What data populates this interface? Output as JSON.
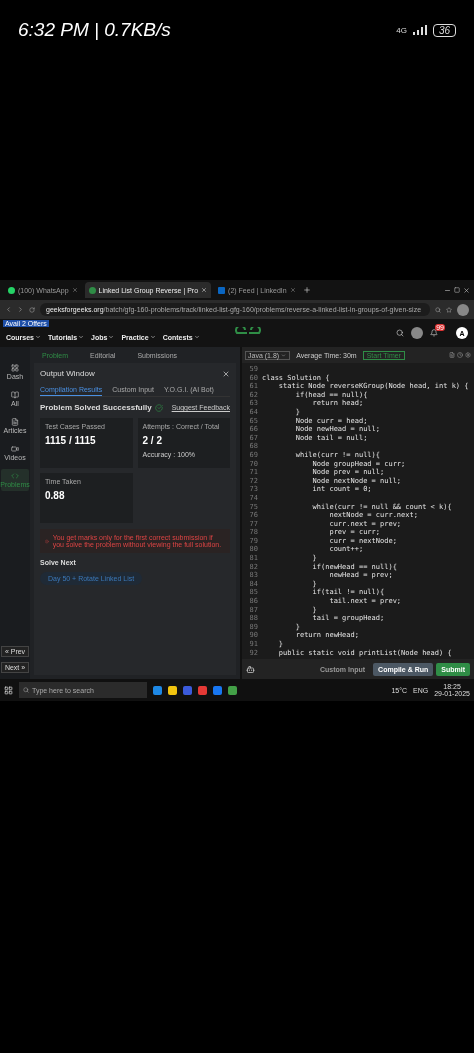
{
  "phone_status": {
    "time": "6:32 PM | 0.7KB/s",
    "network": "4G",
    "battery": "36"
  },
  "browser": {
    "tabs": [
      {
        "title": "(100) WhatsApp",
        "selected": false
      },
      {
        "title": "Linked List Group Reverse | Pro",
        "selected": true
      },
      {
        "title": "(2) Feed | LinkedIn",
        "selected": false
      }
    ],
    "url_domain": "geeksforgeeks.org",
    "url_path": "/batch/gfg-160-problems/track/linked-list-gfg-160/problems/reverse-a-linked-list-in-groups-of-given-size"
  },
  "site_nav": {
    "offer_badge": "Avail 2 Offers",
    "items": [
      "Courses",
      "Tutorials",
      "Jobs",
      "Practice",
      "Contests"
    ],
    "notifications": "99",
    "avatar": "A"
  },
  "problem_tabs": [
    {
      "label": "Problem",
      "selected": true
    },
    {
      "label": "Editorial",
      "selected": false
    },
    {
      "label": "Submissions",
      "selected": false
    }
  ],
  "sidebar": {
    "items": [
      {
        "label": "Dash",
        "selected": false
      },
      {
        "label": "All",
        "selected": false
      },
      {
        "label": "Articles",
        "selected": false
      },
      {
        "label": "Videos",
        "selected": false
      },
      {
        "label": "Problems",
        "selected": true
      }
    ],
    "prev": "« Prev",
    "next": "Next »"
  },
  "output_window": {
    "title": "Output Window",
    "tabs": [
      {
        "label": "Compilation Results",
        "selected": true
      },
      {
        "label": "Custom Input",
        "selected": false
      },
      {
        "label": "Y.O.G.I. (AI Bot)",
        "selected": false
      }
    ],
    "status": "Problem Solved Successfully",
    "feedback": "Suggest Feedback",
    "cards": [
      {
        "label": "Test Cases Passed",
        "value": "1115 / 1115"
      },
      {
        "label": "Attempts : Correct / Total",
        "value": "2 / 2",
        "extra_label": "Accuracy :",
        "extra_value": "100%"
      },
      {
        "label": "Time Taken",
        "value": "0.88"
      }
    ],
    "note": "You get marks only for the first correct submission if you solve the problem without viewing the full solution.",
    "solve_next": "Solve Next",
    "next_problem": "Day 50 + Rotate Linked List"
  },
  "editor": {
    "language": "Java (1.8)",
    "average_time": "Average Time: 30m",
    "timer": "Start Timer",
    "lines": [
      {
        "number": "59"
      },
      {
        "number": "60",
        "text": "class Solution {"
      },
      {
        "number": "61",
        "text": "    static Node reverseKGroup(Node head, int k) {"
      },
      {
        "number": "62",
        "text": "        if(head == null){"
      },
      {
        "number": "63",
        "text": "            return head;"
      },
      {
        "number": "64",
        "text": "        }"
      },
      {
        "number": "65",
        "text": "        Node curr = head;"
      },
      {
        "number": "66",
        "text": "        Node newHead = null;"
      },
      {
        "number": "67",
        "text": "        Node tail = null;"
      },
      {
        "number": "68"
      },
      {
        "number": "69",
        "text": "        while(curr != null){"
      },
      {
        "number": "70",
        "text": "            Node groupHead = curr;"
      },
      {
        "number": "71",
        "text": "            Node prev = null;"
      },
      {
        "number": "72",
        "text": "            Node nextNode = null;"
      },
      {
        "number": "73",
        "text": "            int count = 0;"
      },
      {
        "number": "74"
      },
      {
        "number": "75",
        "text": "            while(curr != null && count < k){"
      },
      {
        "number": "76",
        "text": "                nextNode = curr.next;"
      },
      {
        "number": "77",
        "text": "                curr.next = prev;"
      },
      {
        "number": "78",
        "text": "                prev = curr;"
      },
      {
        "number": "79",
        "text": "                curr = nextNode;"
      },
      {
        "number": "80",
        "text": "                count++;"
      },
      {
        "number": "81",
        "text": "            }"
      },
      {
        "number": "82",
        "text": "            if(newHead == null){"
      },
      {
        "number": "83",
        "text": "                newHead = prev;"
      },
      {
        "number": "84",
        "text": "            }"
      },
      {
        "number": "85",
        "text": "            if(tail != null){"
      },
      {
        "number": "86",
        "text": "                tail.next = prev;"
      },
      {
        "number": "87",
        "text": "            }"
      },
      {
        "number": "88",
        "text": "            tail = groupHead;"
      },
      {
        "number": "89",
        "text": "        }"
      },
      {
        "number": "90",
        "text": "        return newHead;"
      },
      {
        "number": "91",
        "text": "    }"
      },
      {
        "number": "92",
        "text": "    public static void printList(Node head) {"
      }
    ],
    "buttons": [
      {
        "label": "Custom Input",
        "kind": "ghost"
      },
      {
        "label": "Compile & Run",
        "kind": "secondary"
      },
      {
        "label": "Submit",
        "kind": "primary"
      }
    ]
  },
  "taskbar": {
    "search_placeholder": "Type here to search",
    "weather": "15°C",
    "language": "ENG",
    "time": "18:25",
    "date": "29-01-2025"
  }
}
